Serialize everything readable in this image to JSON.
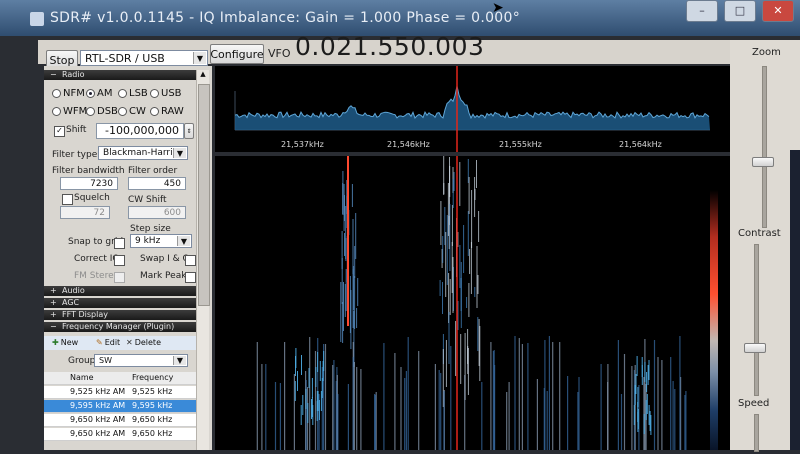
{
  "window": {
    "title": "SDR# v1.0.0.1145 - IQ Imbalance: Gain = 1.000 Phase = 0.000°"
  },
  "toolbar": {
    "stop_label": "Stop",
    "source_value": "RTL-SDR / USB",
    "configure_label": "Configure",
    "vfo_label": "VFO",
    "vfo_value": "0.021.550.003"
  },
  "radio": {
    "section_title": "Radio",
    "modes": [
      "NFM",
      "AM",
      "LSB",
      "USB",
      "WFM",
      "DSB",
      "CW",
      "RAW"
    ],
    "selected_mode": "AM",
    "shift_label": "Shift",
    "shift_checked": true,
    "shift_value": "-100,000,000",
    "filter_type_label": "Filter type",
    "filter_type_value": "Blackman-Harris",
    "filter_bandwidth_label": "Filter bandwidth",
    "filter_bandwidth_value": "7230",
    "filter_order_label": "Filter order",
    "filter_order_value": "450",
    "squelch_label": "Squelch",
    "squelch_value": "72",
    "cw_shift_label": "CW Shift",
    "cw_shift_value": "600",
    "step_size_label": "Step size",
    "snap_to_grid_label": "Snap to grid",
    "step_size_value": "9 kHz",
    "correct_iq_label": "Correct IQ",
    "swap_iq_label": "Swap I & Q",
    "fm_stereo_label": "FM Stereo",
    "mark_peaks_label": "Mark Peaks"
  },
  "sections": {
    "audio": "Audio",
    "agc": "AGC",
    "fft_display": "FFT Display",
    "frequency_manager": "Frequency Manager (Plugin)"
  },
  "frequency_manager": {
    "new_label": "New",
    "edit_label": "Edit",
    "delete_label": "Delete",
    "group_label": "Group:",
    "group_value": "SW",
    "columns": [
      "Name",
      "Frequency"
    ],
    "rows": [
      {
        "name": "9,525 kHz AM",
        "frequency": "9,525 kHz"
      },
      {
        "name": "9,595 kHz AM",
        "frequency": "9,595 kHz"
      },
      {
        "name": "9,650 kHz AM",
        "frequency": "9,650 kHz"
      },
      {
        "name": "9,650 kHz AM",
        "frequency": "9,650 kHz"
      }
    ],
    "selected_row": 1
  },
  "spectrum": {
    "freq_labels": [
      "21,537kHz",
      "21,546kHz",
      "21,555kHz",
      "21,564kHz"
    ],
    "trace_color": "#5fa7d8",
    "fill_color": "#1f5c8a",
    "marker_color": "#e2261a"
  },
  "right_panel": {
    "zoom_label": "Zoom",
    "contrast_label": "Contrast",
    "speed_label": "Speed"
  },
  "colors": {
    "background": "#2a2d33",
    "panel": "#d9d6d0",
    "selection": "#3a8ad8",
    "titlebar": "#3f5f85"
  }
}
